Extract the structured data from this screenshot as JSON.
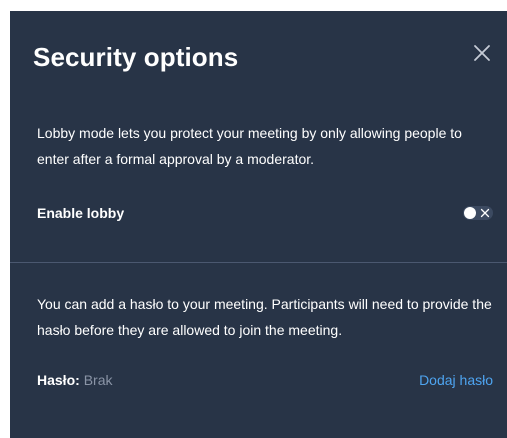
{
  "dialog": {
    "title": "Security options",
    "close_icon": "close-icon"
  },
  "lobby": {
    "description": "Lobby mode lets you protect your meeting by only allowing people to enter after a formal approval by a moderator.",
    "toggle_label": "Enable lobby",
    "toggle_enabled": false
  },
  "password": {
    "description": "You can add a hasło to your meeting. Participants will need to provide the hasło before they are allowed to join the meeting.",
    "label": "Hasło:",
    "value": "Brak",
    "add_link": "Dodaj hasło"
  },
  "colors": {
    "background": "#283447",
    "link": "#4ea4f0",
    "muted_text": "#8a94a6",
    "divider": "#4b5870"
  }
}
